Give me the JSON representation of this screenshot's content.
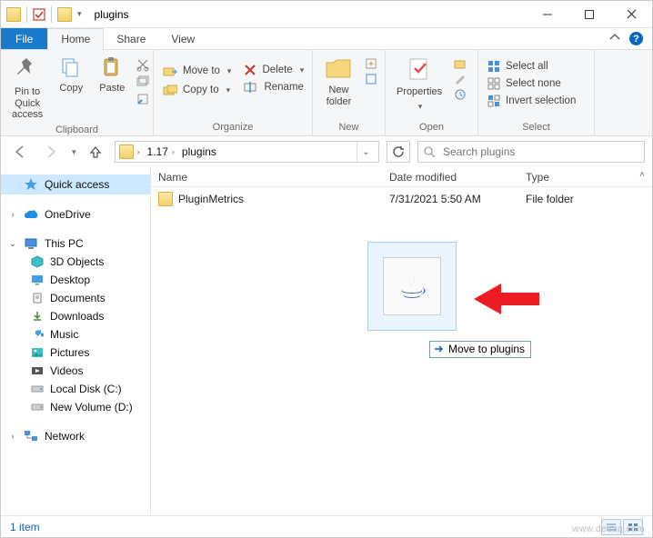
{
  "window": {
    "title": "plugins"
  },
  "tabs": {
    "file": "File",
    "home": "Home",
    "share": "Share",
    "view": "View"
  },
  "ribbon": {
    "clipboard": {
      "label": "Clipboard",
      "pin": "Pin to Quick\naccess",
      "copy": "Copy",
      "paste": "Paste"
    },
    "organize": {
      "label": "Organize",
      "move_to": "Move to",
      "copy_to": "Copy to",
      "delete": "Delete",
      "rename": "Rename"
    },
    "new": {
      "label": "New",
      "new_folder": "New\nfolder"
    },
    "open": {
      "label": "Open",
      "properties": "Properties"
    },
    "select": {
      "label": "Select",
      "all": "Select all",
      "none": "Select none",
      "invert": "Invert selection"
    }
  },
  "breadcrumbs": {
    "a": "1.17",
    "b": "plugins"
  },
  "search": {
    "placeholder": "Search plugins"
  },
  "columns": {
    "name": "Name",
    "date": "Date modified",
    "type": "Type"
  },
  "files": [
    {
      "name": "PluginMetrics",
      "date": "7/31/2021 5:50 AM",
      "type": "File folder"
    }
  ],
  "drag": {
    "tooltip": "Move to plugins"
  },
  "sidebar": {
    "quick_access": "Quick access",
    "onedrive": "OneDrive",
    "this_pc": "This PC",
    "3d": "3D Objects",
    "desktop": "Desktop",
    "documents": "Documents",
    "downloads": "Downloads",
    "music": "Music",
    "pictures": "Pictures",
    "videos": "Videos",
    "local_c": "Local Disk (C:)",
    "vol_d": "New Volume (D:)",
    "network": "Network"
  },
  "status": {
    "count": "1 item"
  },
  "watermark": "www.deuaq.com"
}
